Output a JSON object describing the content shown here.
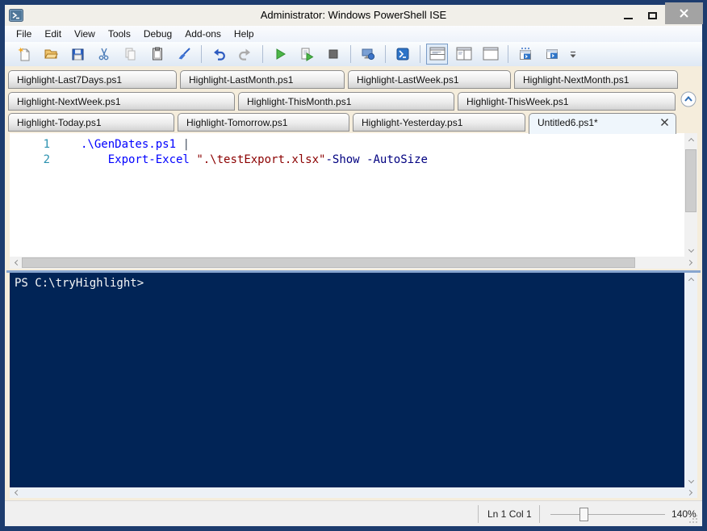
{
  "window": {
    "title": "Administrator: Windows PowerShell ISE",
    "controls": [
      "minimize",
      "maximize",
      "close"
    ]
  },
  "menu": {
    "items": [
      {
        "label": "File"
      },
      {
        "label": "Edit"
      },
      {
        "label": "View"
      },
      {
        "label": "Tools"
      },
      {
        "label": "Debug"
      },
      {
        "label": "Add-ons"
      },
      {
        "label": "Help"
      }
    ]
  },
  "toolbar": {
    "buttons": [
      "new-script",
      "open-script",
      "save-script",
      "cut",
      "copy",
      "paste",
      "clear-console-pane",
      "undo",
      "redo",
      "run-script",
      "run-selection",
      "stop-operation",
      "new-remote-powershell-tab",
      "start-powershell-exe",
      "show-script-pane-top",
      "show-script-pane-right",
      "show-script-pane-maximized",
      "script-pane-window-1",
      "script-pane-window-2",
      "toolbar-overflow"
    ]
  },
  "tabs": {
    "rows": [
      [
        {
          "label": "Highlight-Last7Days.ps1"
        },
        {
          "label": "Highlight-LastMonth.ps1"
        },
        {
          "label": "Highlight-LastWeek.ps1"
        },
        {
          "label": "Highlight-NextMonth.ps1"
        }
      ],
      [
        {
          "label": "Highlight-NextWeek.ps1"
        },
        {
          "label": "Highlight-ThisMonth.ps1"
        },
        {
          "label": "Highlight-ThisWeek.ps1"
        }
      ],
      [
        {
          "label": "Highlight-Today.ps1"
        },
        {
          "label": "Highlight-Tomorrow.ps1"
        },
        {
          "label": "Highlight-Yesterday.ps1"
        },
        {
          "label": "Untitled6.ps1*"
        }
      ]
    ],
    "active_tab": "Untitled6.ps1*"
  },
  "editor": {
    "lines": [
      {
        "number": "1",
        "tokens": [
          {
            "t": ".\\GenDates.ps1",
            "type": "command"
          },
          {
            "t": " ",
            "type": "plain"
          },
          {
            "t": "|",
            "type": "operator"
          }
        ]
      },
      {
        "number": "2",
        "tokens": [
          {
            "t": "    ",
            "type": "plain"
          },
          {
            "t": "Export-Excel",
            "type": "command"
          },
          {
            "t": " ",
            "type": "plain"
          },
          {
            "t": "\".\\testExport.xlsx\"",
            "type": "string"
          },
          {
            "t": "-Show",
            "type": "parameter"
          },
          {
            "t": " ",
            "type": "plain"
          },
          {
            "t": "-AutoSize",
            "type": "parameter"
          }
        ]
      }
    ]
  },
  "console": {
    "prompt": "PS C:\\tryHighlight>"
  },
  "statusbar": {
    "position": "Ln 1 Col 1",
    "zoom_level": "140%"
  },
  "colors": {
    "window_border": "#1D3C6E",
    "console_bg": "#012456",
    "command": "#0000FF",
    "string": "#8B0000",
    "parameter": "#000080",
    "operator": "#424C5E",
    "line_number": "#2B91AF",
    "title_text": "#000000"
  }
}
